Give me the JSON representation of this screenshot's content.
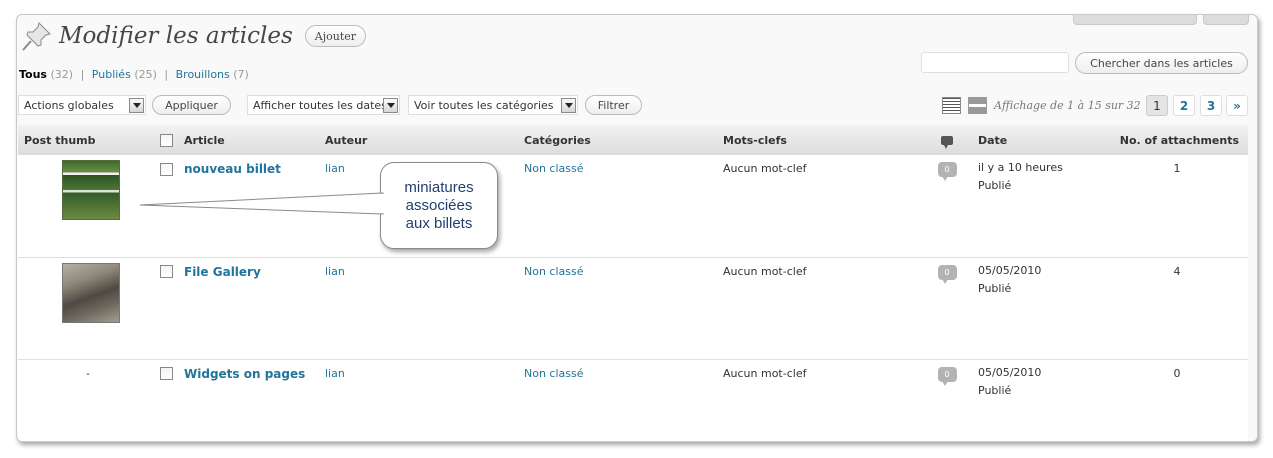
{
  "header": {
    "title": "Modifier les articles",
    "add_label": "Ajouter"
  },
  "filters": {
    "all": {
      "label": "Tous",
      "count": "(32)"
    },
    "published": {
      "label": "Publiés",
      "count": "(25)"
    },
    "drafts": {
      "label": "Brouillons",
      "count": "(7)"
    },
    "separator": "|"
  },
  "search": {
    "value": "",
    "button_label": "Chercher dans les articles"
  },
  "toolbar": {
    "bulk_actions": "Actions globales",
    "apply_label": "Appliquer",
    "dates_select": "Afficher toutes les dates",
    "categories_select": "Voir toutes les catégories",
    "filter_label": "Filtrer"
  },
  "pagination": {
    "info": "Affichage de 1 à 15 sur 32",
    "pages": [
      "1",
      "2",
      "3"
    ],
    "next": "»",
    "current": "1"
  },
  "table": {
    "headers": {
      "thumb": "Post thumb",
      "article": "Article",
      "author": "Auteur",
      "categories": "Catégories",
      "tags": "Mots-clefs",
      "date": "Date",
      "attachments": "No. of attachments"
    },
    "rows": [
      {
        "thumb": "",
        "title": "nouveau billet",
        "author": "lian",
        "category": "Non classé",
        "tags": "Aucun mot-clef",
        "comments": "0",
        "date": "il y a 10 heures",
        "status": "Publié",
        "attachments": "1"
      },
      {
        "thumb": "",
        "title": "File Gallery",
        "author": "lian",
        "category": "Non classé",
        "tags": "Aucun mot-clef",
        "comments": "0",
        "date": "05/05/2010",
        "status": "Publié",
        "attachments": "4"
      },
      {
        "thumb": "-",
        "title": "Widgets on pages",
        "author": "lian",
        "category": "Non classé",
        "tags": "Aucun mot-clef",
        "comments": "0",
        "date": "05/05/2010",
        "status": "Publié",
        "attachments": "0"
      }
    ]
  },
  "callout": {
    "line1": "miniatures",
    "line2": "associées",
    "line3": "aux billets"
  },
  "icons": {
    "pin": "pushpin-icon",
    "comments": "comment-bubble-icon",
    "list_view": "list-view-icon",
    "excerpt_view": "excerpt-view-icon"
  },
  "colors": {
    "link": "#21759b",
    "callout_text": "#1f3f6f",
    "header_bg": "#dfdfdf"
  }
}
